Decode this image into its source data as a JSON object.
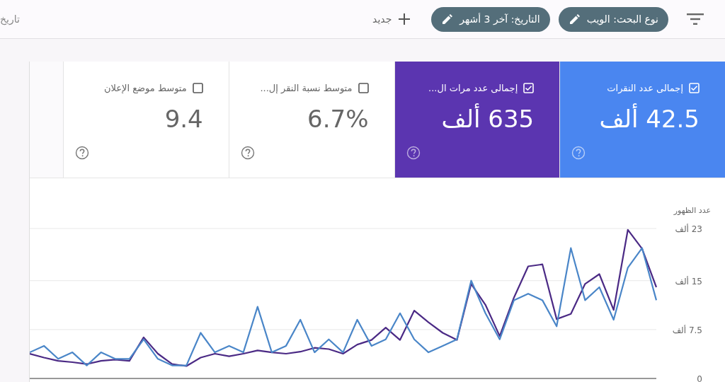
{
  "top_bar": {
    "chips": [
      {
        "label": "نوع البحث: الويب"
      },
      {
        "label": "التاريخ: آخر 3 أشهر"
      }
    ],
    "new_button": {
      "label": "جديد"
    },
    "date_label": "تاريخ"
  },
  "metrics": [
    {
      "label": "إجمالى عدد النقرات",
      "value": "42.5 ألف",
      "checked": true,
      "color": "#4a86f0"
    },
    {
      "label": "إجمالى عدد مرات ال...",
      "value": "635 ألف",
      "checked": true,
      "color": "#5b35b0"
    },
    {
      "label": "متوسط نسبة النقر إل...",
      "value": "6.7%",
      "checked": false
    },
    {
      "label": "متوسط موضع الإعلان",
      "value": "9.4",
      "checked": false
    }
  ],
  "chart": {
    "chart_data": {
      "type": "line",
      "ylabel": "عدد الظهور",
      "ylim": [
        0,
        23
      ],
      "yticks": [
        {
          "value": 0,
          "label": "0"
        },
        {
          "value": 7.5,
          "label": "7.5 ألف"
        },
        {
          "value": 15,
          "label": "15 ألف"
        },
        {
          "value": 23,
          "label": "23 ألف"
        }
      ],
      "series": [
        {
          "color": "#4b2a85",
          "values": [
            3.8,
            3.2,
            2.7,
            2.5,
            2.2,
            2.7,
            2.9,
            2.7,
            6.3,
            3.8,
            2.2,
            1.9,
            3.2,
            3.8,
            3.4,
            3.8,
            4.3,
            4.0,
            3.8,
            4.1,
            4.7,
            4.5,
            3.8,
            5.2,
            5.9,
            7.8,
            5.9,
            10.4,
            8.6,
            7.0,
            5.9,
            14.5,
            11.3,
            6.5,
            12.4,
            17.2,
            17.5,
            9.1,
            9.9,
            14.5,
            16.0,
            10.5,
            22.8,
            19.9,
            14.0
          ]
        },
        {
          "color": "#4a86c8",
          "values": [
            4,
            5,
            3,
            4,
            2,
            4,
            3,
            3,
            6,
            3,
            2,
            2,
            7,
            4,
            5,
            4,
            11,
            4,
            5,
            9,
            4,
            6,
            4,
            9,
            5,
            6,
            10,
            6,
            4,
            5,
            6,
            15,
            10,
            6,
            12,
            13,
            12,
            8,
            20,
            12,
            14,
            9,
            17,
            20,
            12
          ]
        }
      ]
    }
  }
}
